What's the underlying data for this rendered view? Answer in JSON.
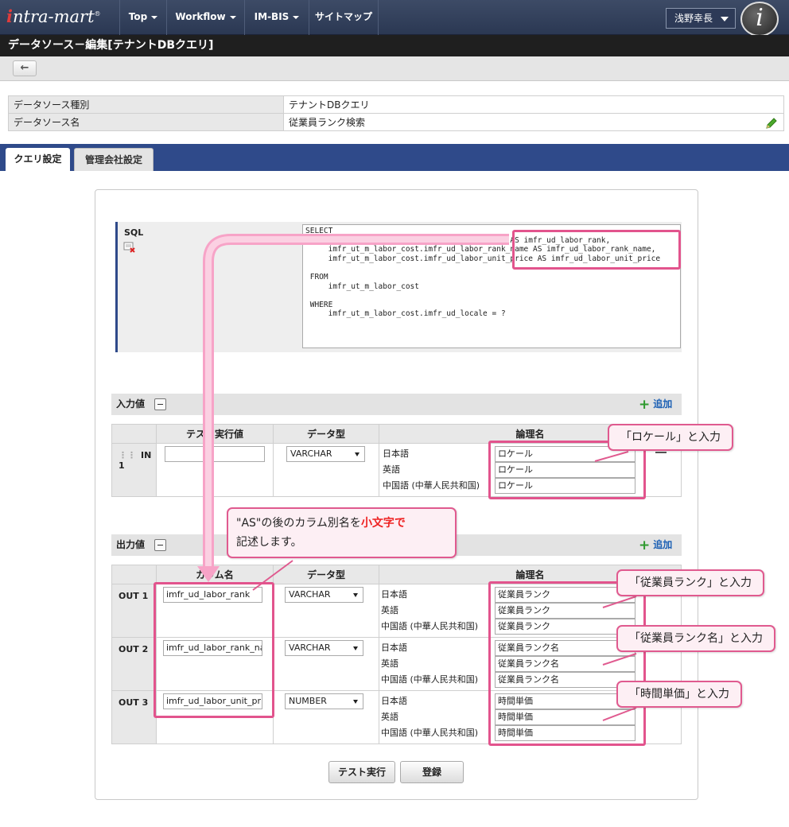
{
  "header": {
    "logo_prefix": "i",
    "logo_text": "ntra-mart",
    "logo_mark": "®",
    "nav": [
      "Top",
      "Workflow",
      "IM-BIS",
      "サイトマップ"
    ],
    "user": "浅野幸長",
    "avatar_letter": "i"
  },
  "page_title": "データソース－編集[テナントDBクエリ]",
  "back_icon": "arrow-left-icon",
  "info": {
    "rows": [
      {
        "key": "データソース種別",
        "value": "テナントDBクエリ"
      },
      {
        "key": "データソース名",
        "value": "従業員ランク検索"
      }
    ]
  },
  "tabs": [
    "クエリ設定",
    "管理会社設定"
  ],
  "sql": {
    "label": "SQL",
    "text": "SELECT\n     imfr_ut_m_labor_cost.imfr_ud_labor_rank AS imfr_ud_labor_rank,\n     imfr_ut_m_labor_cost.imfr_ud_labor_rank_name AS imfr_ud_labor_rank_name,\n     imfr_ut_m_labor_cost.imfr_ud_labor_unit_price AS imfr_ud_labor_unit_price\n\n FROM\n     imfr_ut_m_labor_cost\n\n WHERE\n     imfr_ut_m_labor_cost.imfr_ud_locale = ?"
  },
  "input_section": {
    "title": "入力値",
    "add_label": "追加",
    "columns": [
      "テスト実行値",
      "データ型",
      "論理名"
    ],
    "rows": [
      {
        "id": "IN 1",
        "value": "",
        "type": "VARCHAR",
        "languages": [
          "日本語",
          "英語",
          "中国語 (中華人民共和国)"
        ],
        "names": [
          "ロケール",
          "ロケール",
          "ロケール"
        ]
      }
    ]
  },
  "output_section": {
    "title": "出力値",
    "add_label": "追加",
    "columns": [
      "カラム名",
      "データ型",
      "論理名"
    ],
    "rows": [
      {
        "id": "OUT 1",
        "column": "imfr_ud_labor_rank",
        "type": "VARCHAR",
        "languages": [
          "日本語",
          "英語",
          "中国語 (中華人民共和国)"
        ],
        "names": [
          "従業員ランク",
          "従業員ランク",
          "従業員ランク"
        ]
      },
      {
        "id": "OUT 2",
        "column": "imfr_ud_labor_rank_name",
        "type": "VARCHAR",
        "languages": [
          "日本語",
          "英語",
          "中国語 (中華人民共和国)"
        ],
        "names": [
          "従業員ランク名",
          "従業員ランク名",
          "従業員ランク名"
        ]
      },
      {
        "id": "OUT 3",
        "column": "imfr_ud_labor_unit_price",
        "type": "NUMBER",
        "languages": [
          "日本語",
          "英語",
          "中国語 (中華人民共和国)"
        ],
        "names": [
          "時間単価",
          "時間単価",
          "時間単価"
        ]
      }
    ]
  },
  "buttons": {
    "test": "テスト実行",
    "register": "登録"
  },
  "callouts": {
    "locale": "「ロケール」と入力",
    "as_note_1": "\"AS\"の後のカラム別名を",
    "as_note_bold": "小文字で",
    "as_note_2": "記述します。",
    "rank": "「従業員ランク」と入力",
    "rank_name": "「従業員ランク名」と入力",
    "unit_price": "「時間単価」と入力"
  },
  "colors": {
    "header": "#2b3853",
    "tabs": "#2f4a8a",
    "highlight": "#e2548d"
  }
}
